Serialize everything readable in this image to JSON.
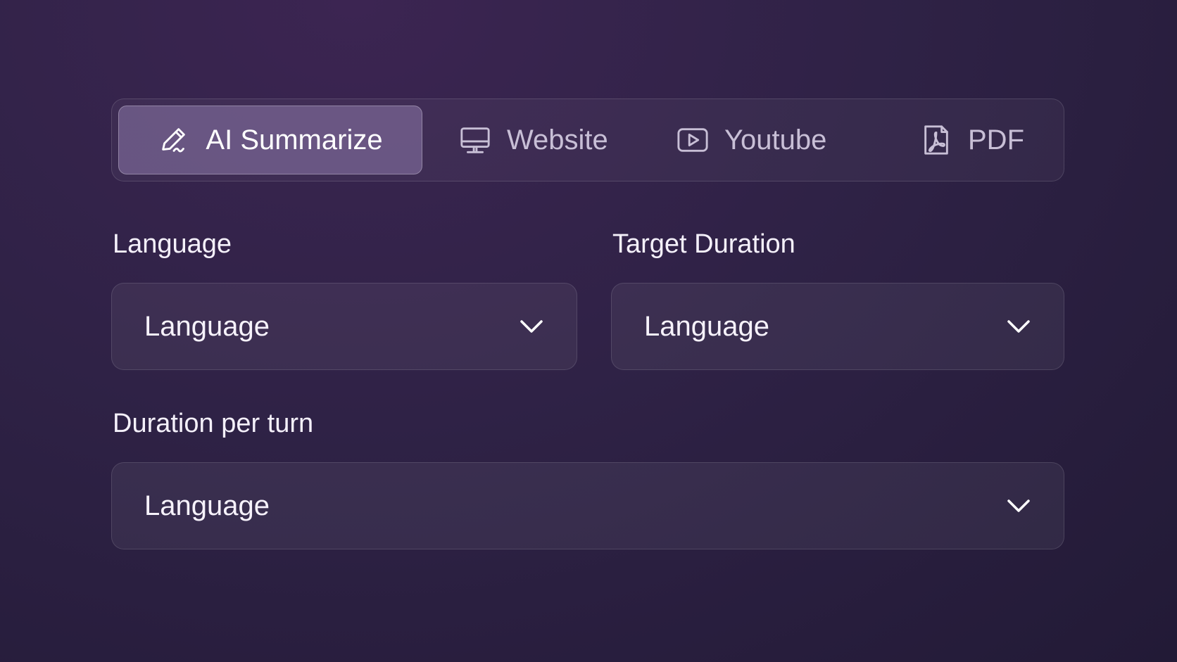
{
  "tabs": [
    {
      "label": "AI Summarize",
      "icon": "pen-icon",
      "active": true
    },
    {
      "label": "Website",
      "icon": "monitor-icon",
      "active": false
    },
    {
      "label": "Youtube",
      "icon": "play-video-icon",
      "active": false
    },
    {
      "label": "PDF",
      "icon": "pdf-file-icon",
      "active": false
    }
  ],
  "fields": {
    "language": {
      "label": "Language",
      "value": "Language"
    },
    "target_duration": {
      "label": "Target Duration",
      "value": "Language"
    },
    "duration_per_turn": {
      "label": "Duration per turn",
      "value": "Language"
    }
  },
  "colors": {
    "background": "#2f2246",
    "active_tab": "#5c4e78",
    "text": "#f4f0fa",
    "muted_text": "#c8bfd6"
  }
}
